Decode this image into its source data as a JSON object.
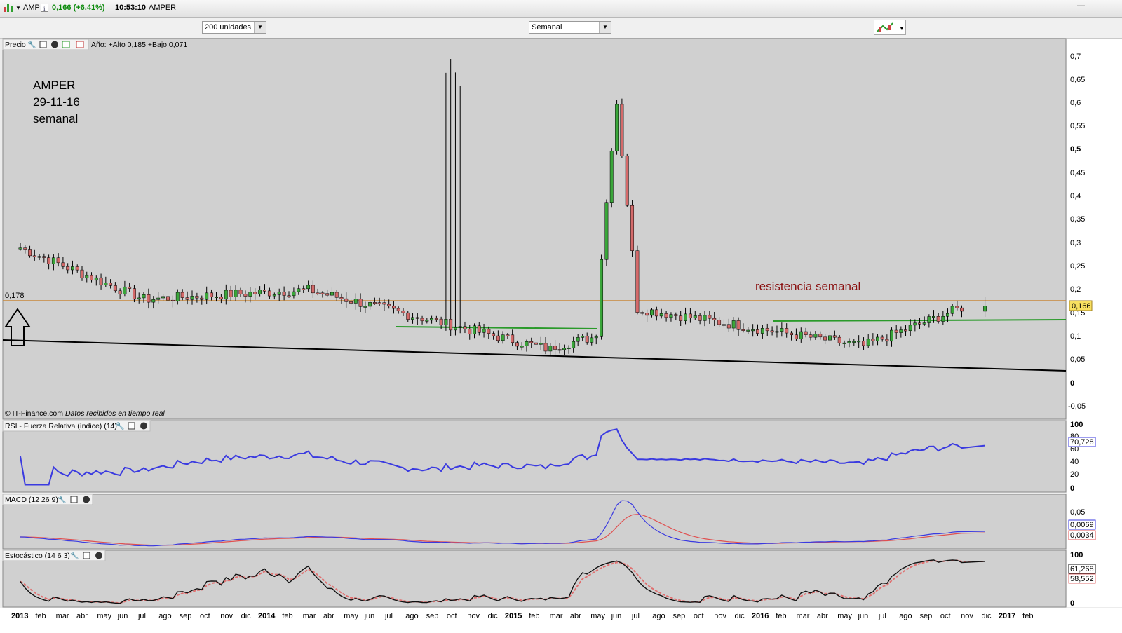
{
  "window": {
    "symbol": "AMP",
    "quote": "0,166 (+6,41%)",
    "time": "10:53:10",
    "name": "AMPER",
    "minimize": "—"
  },
  "toolbar": {
    "units_select": "200 unidades",
    "period_select": "Semanal"
  },
  "price_panel": {
    "label": "Precio",
    "stats": "Año: +Alto 0,185 +Bajo 0,071",
    "annotation_lines": [
      "AMPER",
      "29-11-16",
      "semanal"
    ],
    "resistance_label": "resistencia semanal",
    "resistance_level_label": "0,178",
    "last_price_label": "0,166",
    "credit": "© IT-Finance.com",
    "credit_note": "Datos recibidos en tiempo real",
    "y_ticks": [
      "0,7",
      "0,65",
      "0,6",
      "0,55",
      "0,5",
      "0,45",
      "0,4",
      "0,35",
      "0,3",
      "0,25",
      "0,2",
      "0,15",
      "0,1",
      "0,05",
      "0",
      "-0,05"
    ]
  },
  "rsi_panel": {
    "label": "RSI - Fuerza Relativa (índice) (14)",
    "y_ticks": [
      "100",
      "80",
      "60",
      "40",
      "20",
      "0"
    ],
    "last_label": "70,728"
  },
  "macd_panel": {
    "label": "MACD (12 26 9)",
    "y_ticks": [
      "0,05"
    ],
    "last_macd": "0,0069",
    "last_signal": "0,0034"
  },
  "stoch_panel": {
    "label": "Estocástico (14 6 3)",
    "y_ticks": [
      "100",
      "0"
    ],
    "last_k": "61,268",
    "last_d": "58,552"
  },
  "x_axis": {
    "labels": [
      "2013",
      "feb",
      "mar",
      "abr",
      "may",
      "jun",
      "jul",
      "ago",
      "sep",
      "oct",
      "nov",
      "dic",
      "2014",
      "feb",
      "mar",
      "abr",
      "may",
      "jun",
      "jul",
      "ago",
      "sep",
      "oct",
      "nov",
      "dic",
      "2015",
      "feb",
      "mar",
      "abr",
      "may",
      "jun",
      "jul",
      "ago",
      "sep",
      "oct",
      "nov",
      "dic",
      "2016",
      "feb",
      "mar",
      "abr",
      "may",
      "jun",
      "jul",
      "ago",
      "sep",
      "oct",
      "nov",
      "dic",
      "2017",
      "feb"
    ],
    "bold": [
      "2013",
      "2014",
      "2015",
      "2016",
      "2017"
    ]
  },
  "colors": {
    "up": "#3aa63a",
    "down": "#d46a6a",
    "resistance": "#c8883a",
    "rsi": "#3a3ae0",
    "macd": "#3a3ae0",
    "signal": "#e05050",
    "stoch_k": "#111111",
    "stoch_d": "#e07070",
    "trend_support": "#000000",
    "trend_green": "#2a9a2a",
    "panel_bg": "#d0d0d0"
  },
  "chart_data": {
    "type": "candlestick",
    "title": "AMPER",
    "subtitle": "29-11-16 semanal",
    "period": "weekly",
    "ylim": [
      -0.05,
      0.7
    ],
    "resistance": 0.178,
    "annotations": [
      "resistencia semanal"
    ],
    "ohlc_segments": [
      {
        "from": "2013-01",
        "to": "2013-07",
        "start": 0.29,
        "end": 0.18,
        "max": 0.36
      },
      {
        "from": "2013-07",
        "to": "2014-03",
        "start": 0.18,
        "end": 0.2,
        "max": 0.27
      },
      {
        "from": "2014-03",
        "to": "2015-03",
        "start": 0.2,
        "end": 0.07,
        "min": 0.06
      },
      {
        "from": "2015-03",
        "to": "2015-05",
        "start": 0.08,
        "end": 0.1
      },
      {
        "from": "2015-05",
        "to": "2015-06",
        "start": 0.1,
        "end": 0.6,
        "max": 0.74
      },
      {
        "from": "2015-06",
        "to": "2015-07",
        "start": 0.6,
        "end": 0.17
      },
      {
        "from": "2015-07",
        "to": "2016-06",
        "start": 0.16,
        "end": 0.08,
        "min": 0.071
      },
      {
        "from": "2016-06",
        "to": "2016-11",
        "start": 0.08,
        "end": 0.166,
        "max": 0.185
      }
    ],
    "last": 0.166,
    "year_high": 0.185,
    "year_low": 0.071
  }
}
